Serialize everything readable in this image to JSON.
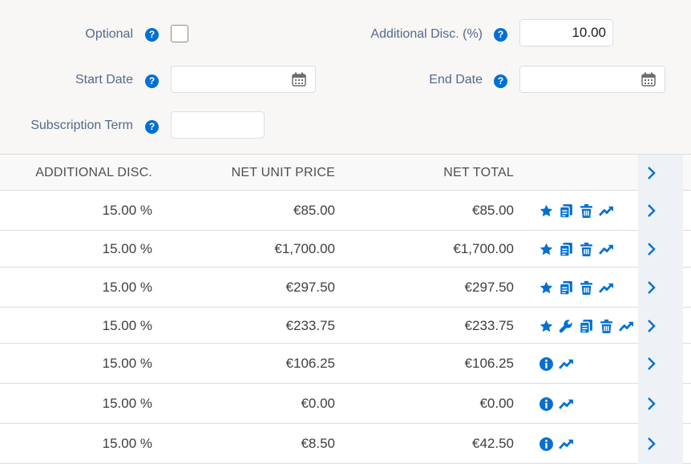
{
  "form": {
    "optional_label": "Optional",
    "additional_disc_label": "Additional Disc. (%)",
    "additional_disc_value": "10.00",
    "start_date_label": "Start Date",
    "end_date_label": "End Date",
    "subscription_term_label": "Subscription Term",
    "help_glyph": "?"
  },
  "table": {
    "headers": [
      "ADDITIONAL DISC.",
      "NET UNIT PRICE",
      "NET TOTAL"
    ],
    "rows": [
      {
        "disc": "15.00 %",
        "unit": "€85.00",
        "total": "€85.00",
        "actions": [
          "star-icon",
          "copy-icon",
          "trash-icon",
          "trend-icon"
        ]
      },
      {
        "disc": "15.00 %",
        "unit": "€1,700.00",
        "total": "€1,700.00",
        "actions": [
          "star-icon",
          "copy-icon",
          "trash-icon",
          "trend-icon"
        ]
      },
      {
        "disc": "15.00 %",
        "unit": "€297.50",
        "total": "€297.50",
        "actions": [
          "star-icon",
          "copy-icon",
          "trash-icon",
          "trend-icon"
        ]
      },
      {
        "disc": "15.00 %",
        "unit": "€233.75",
        "total": "€233.75",
        "actions": [
          "star-icon",
          "wrench-icon",
          "copy-icon",
          "trash-icon",
          "trend-icon"
        ]
      },
      {
        "disc": "15.00 %",
        "unit": "€106.25",
        "total": "€106.25",
        "actions": [
          "info-icon",
          "trend-icon"
        ]
      },
      {
        "disc": "15.00 %",
        "unit": "€0.00",
        "total": "€0.00",
        "actions": [
          "info-icon",
          "trend-icon"
        ]
      },
      {
        "disc": "15.00 %",
        "unit": "€8.50",
        "total": "€42.50",
        "actions": [
          "info-icon",
          "trend-icon"
        ]
      }
    ]
  },
  "colors": {
    "accent": "#0070d2",
    "label": "#54698d",
    "border": "#dddbda"
  }
}
